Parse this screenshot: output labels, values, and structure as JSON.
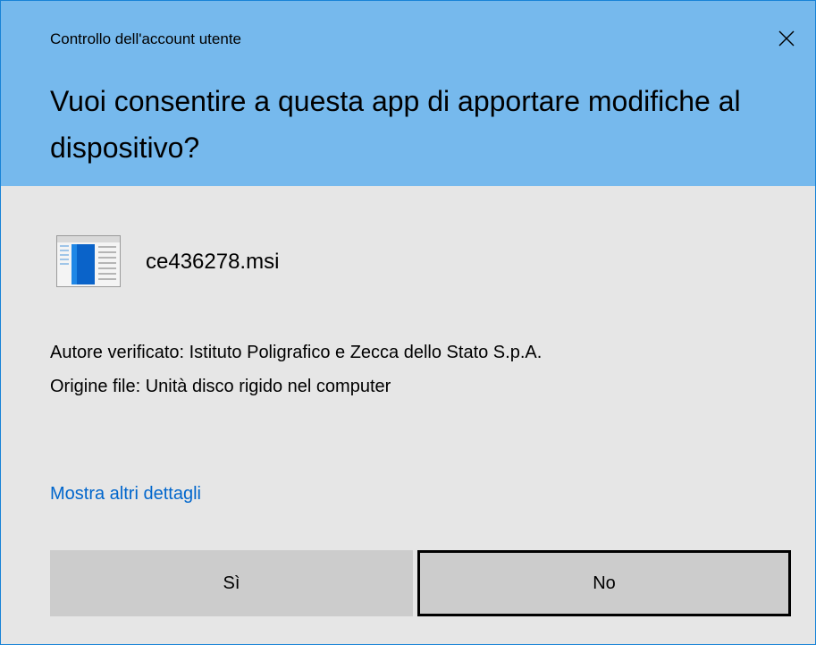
{
  "window": {
    "title": "Controllo dell'account utente",
    "close_icon": "close-icon"
  },
  "header": {
    "question": "Vuoi consentire a questa app di apportare modifiche al dispositivo?"
  },
  "program": {
    "icon": "installer-window-icon",
    "name": "ce436278.msi"
  },
  "details": {
    "publisher_line": "Autore verificato: Istituto Poligrafico e Zecca dello Stato S.p.A.",
    "origin_line": "Origine file: Unità disco rigido nel computer"
  },
  "link": {
    "more_details": "Mostra altri dettagli"
  },
  "buttons": {
    "yes": "Sì",
    "no": "No"
  },
  "colors": {
    "header_bg": "#76b9ed",
    "body_bg": "#e6e6e6",
    "link": "#0066cc",
    "button_bg": "#cccccc",
    "window_border": "#1883d7"
  }
}
